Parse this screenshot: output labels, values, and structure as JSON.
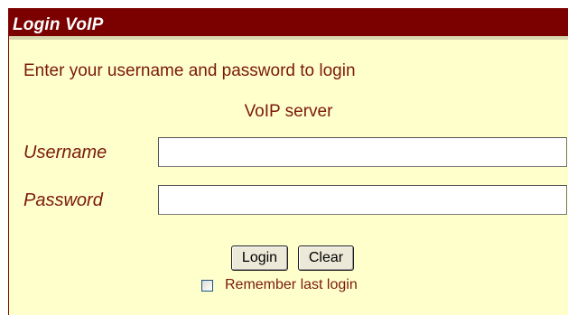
{
  "title": "Login VoIP",
  "intro_text": "Enter your username and password to login",
  "server_text": "VoIP server",
  "username": {
    "label": "Username",
    "value": ""
  },
  "password": {
    "label": "Password",
    "value": ""
  },
  "buttons": {
    "login_label": "Login",
    "clear_label": "Clear"
  },
  "remember": {
    "label": "Remember last login",
    "checked": false
  },
  "colors": {
    "header_bg": "#7b0000",
    "panel_bg": "#ffffcc",
    "label_text": "#7b1a0a"
  }
}
